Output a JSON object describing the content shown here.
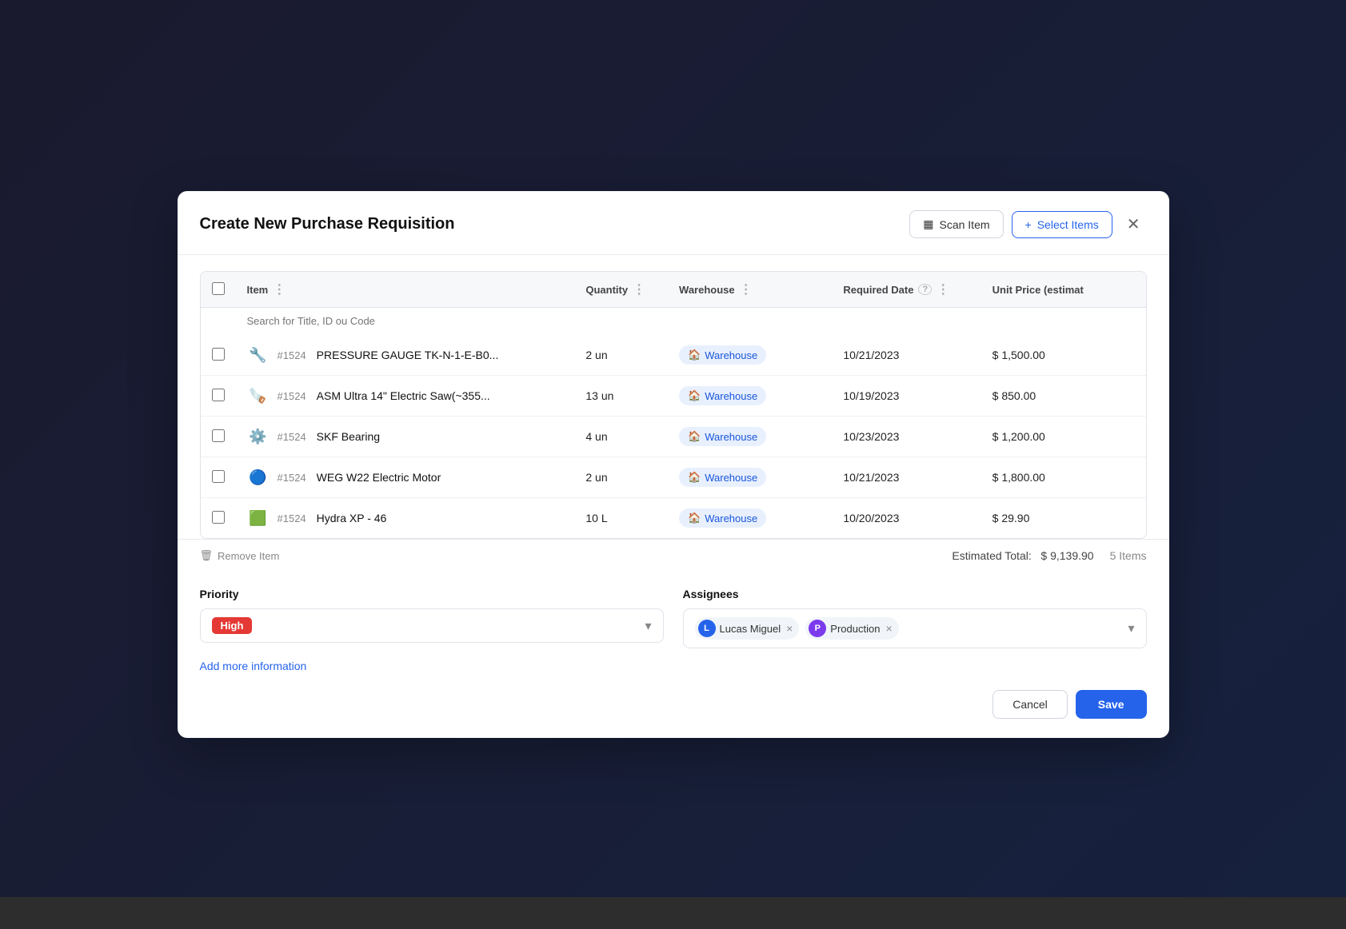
{
  "modal": {
    "title": "Create New Purchase Requisition",
    "scan_button": "Scan Item",
    "select_button": "Select Items",
    "close_label": "✕"
  },
  "table": {
    "columns": {
      "item": "Item",
      "quantity": "Quantity",
      "warehouse": "Warehouse",
      "required_date": "Required Date",
      "unit_price": "Unit Price (estimat"
    },
    "search_placeholder": "Search for Title, ID ou Code",
    "rows": [
      {
        "icon": "🔧",
        "id": "#1524",
        "name": "PRESSURE GAUGE TK-N-1-E-B0...",
        "quantity": "2 un",
        "warehouse": "Warehouse",
        "date": "10/21/2023",
        "price": "$ 1,500.00"
      },
      {
        "icon": "🪚",
        "id": "#1524",
        "name": "ASM Ultra 14\" Electric Saw(~355...",
        "quantity": "13 un",
        "warehouse": "Warehouse",
        "date": "10/19/2023",
        "price": "$ 850.00"
      },
      {
        "icon": "⚙️",
        "id": "#1524",
        "name": "SKF Bearing",
        "quantity": "4 un",
        "warehouse": "Warehouse",
        "date": "10/23/2023",
        "price": "$ 1,200.00"
      },
      {
        "icon": "🔵",
        "id": "#1524",
        "name": "WEG W22 Electric Motor",
        "quantity": "2 un",
        "warehouse": "Warehouse",
        "date": "10/21/2023",
        "price": "$ 1,800.00"
      },
      {
        "icon": "🟩",
        "id": "#1524",
        "name": "Hydra XP - 46",
        "quantity": "10 L",
        "warehouse": "Warehouse",
        "date": "10/20/2023",
        "price": "$ 29.90"
      }
    ]
  },
  "footer": {
    "remove_label": "Remove Item",
    "estimated_total_label": "Estimated Total:",
    "estimated_total_value": "$ 9,139.90",
    "items_count": "5 Items"
  },
  "priority": {
    "label": "Priority",
    "value": "High"
  },
  "assignees": {
    "label": "Assignees",
    "items": [
      {
        "initial": "L",
        "name": "Lucas Miguel",
        "color": "avatar-l"
      },
      {
        "initial": "P",
        "name": "Production",
        "color": "avatar-p"
      }
    ]
  },
  "add_info": "Add more information",
  "actions": {
    "cancel": "Cancel",
    "save": "Save"
  }
}
